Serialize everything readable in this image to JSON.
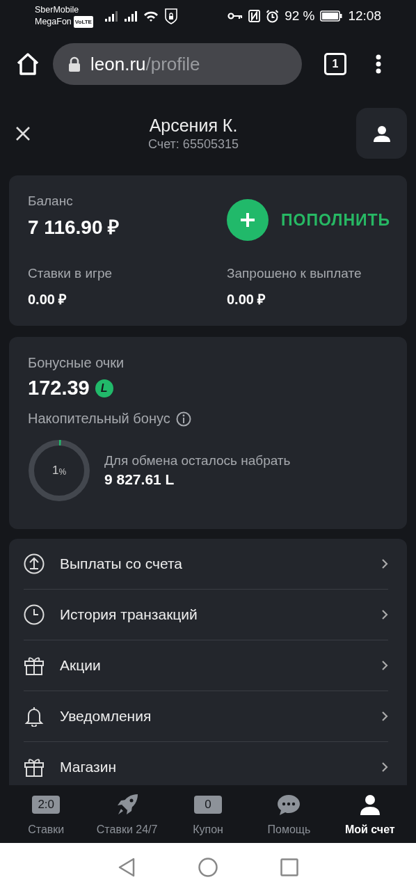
{
  "status_bar": {
    "carrier_1": "SberMobile",
    "carrier_2": "MegaFon",
    "volte": "VoLTE",
    "battery": "92 %",
    "time": "12:08"
  },
  "browser": {
    "domain": "leon.ru",
    "path": "/profile",
    "tab_count": "1"
  },
  "header": {
    "name": "Арсения К.",
    "account": "Счет: 65505315"
  },
  "balance": {
    "label": "Баланс",
    "value": "7 116.90 ₽",
    "top_up": "ПОПОЛНИТЬ",
    "bets_label": "Ставки в игре",
    "bets_value": "0.00 ₽",
    "requested_label": "Запрошено к выплате",
    "requested_value": "0.00 ₽"
  },
  "bonus": {
    "label": "Бонусные очки",
    "value": "172.39",
    "coin": "L",
    "cumulative_label": "Накопительный бонус",
    "progress": {
      "number": "1",
      "unit": "%"
    },
    "remaining_label": "Для обмена осталось набрать",
    "remaining_value": "9 827.61 L"
  },
  "menu": [
    {
      "label": "Выплаты со счета"
    },
    {
      "label": "История транзакций"
    },
    {
      "label": "Акции"
    },
    {
      "label": "Уведомления"
    },
    {
      "label": "Магазин"
    }
  ],
  "bottom_nav": [
    {
      "label": "Ставки",
      "kind": "badge",
      "badge": "2:0",
      "selected": false
    },
    {
      "label": "Ставки 24/7",
      "kind": "icon",
      "selected": false
    },
    {
      "label": "Купон",
      "kind": "badge",
      "badge": "0",
      "selected": false
    },
    {
      "label": "Помощь",
      "kind": "icon",
      "selected": false
    },
    {
      "label": "Мой счет",
      "kind": "icon",
      "selected": true
    }
  ]
}
